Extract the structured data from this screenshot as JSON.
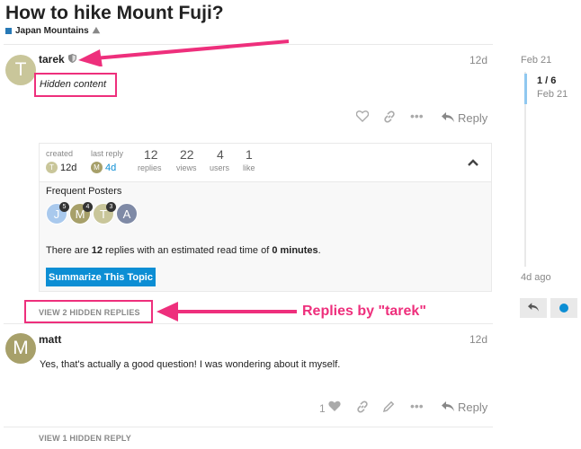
{
  "topic": {
    "title": "How to hike Mount Fuji?",
    "category": "Japan Mountains",
    "category_color": "#2779b6"
  },
  "first_post": {
    "avatar_letter": "T",
    "avatar_color": "#c9c69a",
    "username": "tarek",
    "date": "12d",
    "content": "Hidden content",
    "reply_label": "Reply"
  },
  "summary": {
    "created_label": "created",
    "created_avatar": "T",
    "created_value": "12d",
    "last_reply_label": "last reply",
    "last_reply_avatar": "M",
    "last_reply_value": "4d",
    "replies_num": "12",
    "replies_label": "replies",
    "views_num": "22",
    "views_label": "views",
    "users_num": "4",
    "users_label": "users",
    "likes_num": "1",
    "likes_label": "like",
    "frequent_posters_label": "Frequent Posters",
    "posters": [
      {
        "letter": "J",
        "count": "5",
        "color": "#a9c9ed"
      },
      {
        "letter": "M",
        "count": "4",
        "color": "#a7a06a"
      },
      {
        "letter": "T",
        "count": "3",
        "color": "#c9c69a"
      },
      {
        "letter": "A",
        "count": "",
        "color": "#7f8aa6"
      }
    ],
    "read_time_prefix": "There are ",
    "read_time_replies": "12",
    "read_time_middle": " replies with an estimated read time of ",
    "read_time_minutes": "0 minutes",
    "read_time_suffix": ".",
    "summarize_label": "Summarize This Topic"
  },
  "hidden_replies_1": "VIEW 2 HIDDEN REPLIES",
  "annotation": "Replies by \"tarek\"",
  "second_post": {
    "avatar_letter": "M",
    "avatar_color": "#a7a06a",
    "username": "matt",
    "date": "12d",
    "content": "Yes, that's actually a good question! I was wondering about it myself.",
    "like_count": "1",
    "reply_label": "Reply"
  },
  "hidden_replies_2": "VIEW 1 HIDDEN REPLY",
  "timeline": {
    "top_date": "Feb 21",
    "position": "1 / 6",
    "position_date": "Feb 21",
    "bottom_date": "4d ago"
  },
  "icons": {
    "shield": "shield-icon",
    "like": "heart-icon",
    "link": "link-icon",
    "more": "ellipsis-icon",
    "reply": "reply-arrow-icon",
    "collapse": "chevron-up-icon",
    "edit": "pencil-icon",
    "notification": "blue-dot-icon",
    "category": "mountain-icon"
  }
}
